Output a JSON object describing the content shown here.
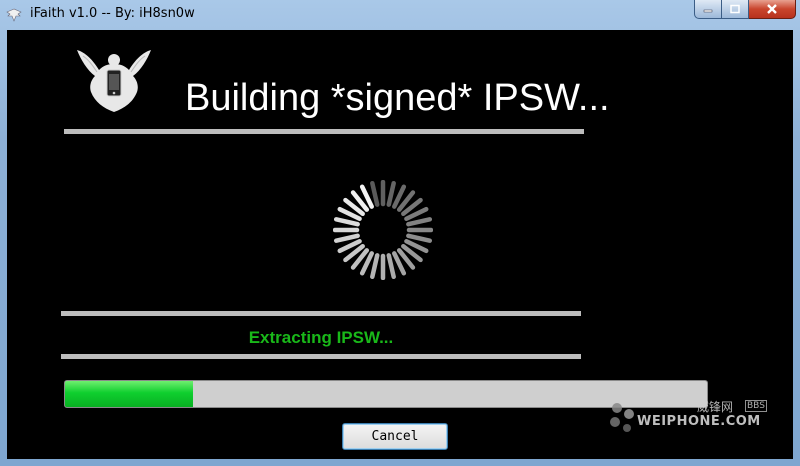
{
  "window": {
    "title": "iFaith v1.0 -- By: iH8sn0w",
    "minimize_icon": "minimize-icon",
    "maximize_icon": "maximize-icon",
    "close_icon": "close-icon"
  },
  "main": {
    "heading": "Building *signed* IPSW...",
    "logo_icon": "dove-phone-logo",
    "spinner_icon": "loading-spinner-icon",
    "status": "Extracting IPSW...",
    "status_color": "#19b819",
    "progress_percent": 20
  },
  "buttons": {
    "cancel_label": "Cancel"
  },
  "watermark": {
    "cn_text": "威锋网",
    "bbs_text": "BBS",
    "en_text": "WEIPHONE.COM"
  }
}
